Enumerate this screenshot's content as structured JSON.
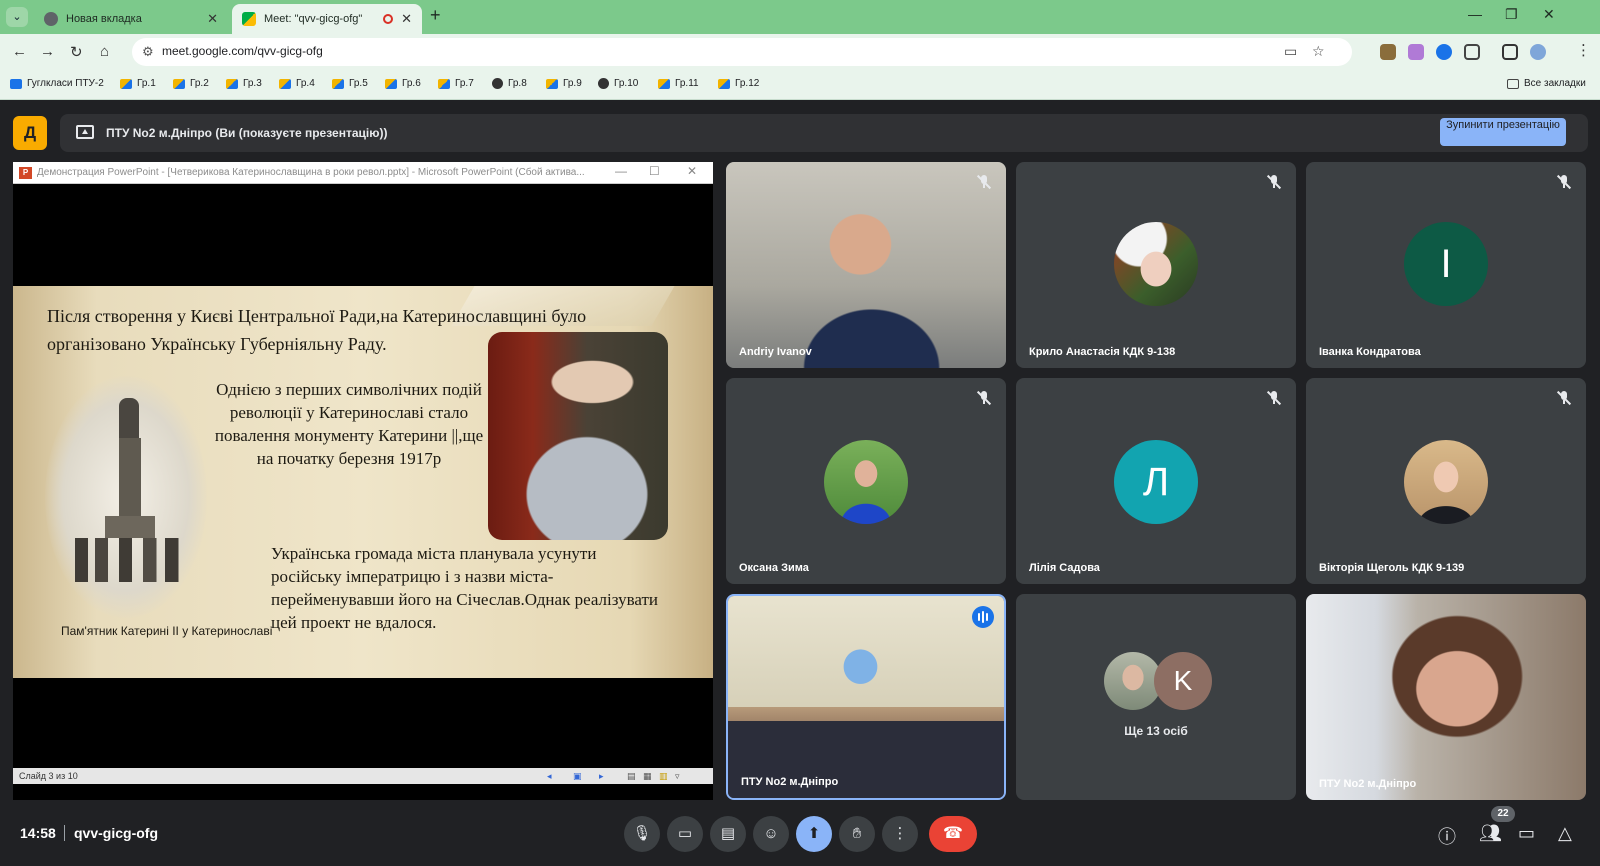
{
  "browser": {
    "tabs": [
      {
        "label": "Новая вкладка",
        "active": false
      },
      {
        "label": "Meet: \"qvv-gicg-ofg\"",
        "active": true
      }
    ],
    "url": "meet.google.com/qvv-gicg-ofg",
    "bookmarks": [
      "Гуглкласи ПТУ-2",
      "Гр.1",
      "Гр.2",
      "Гр.3",
      "Гр.4",
      "Гр.5",
      "Гр.6",
      "Гр.7",
      "Гр.8",
      "Гр.9",
      "Гр.10",
      "Гр.11",
      "Гр.12"
    ],
    "all_bookmarks": "Все закладки"
  },
  "meet": {
    "presenting_banner": "ПТУ No2 м.Дніпро (Ви (показуєте презентацію))",
    "stop_button": "Зупинити презентацію",
    "time": "14:58",
    "meeting_code": "qvv-gicg-ofg",
    "participant_count": "22",
    "participants": [
      {
        "name": "Andriy Ivanov",
        "muted": true,
        "type": "video"
      },
      {
        "name": "Крило Анастасія КДК 9-138",
        "muted": true,
        "type": "photo"
      },
      {
        "name": "Іванка Кондратова",
        "muted": true,
        "type": "letter",
        "letter": "І",
        "color": "#0d5a45"
      },
      {
        "name": "Оксана Зима",
        "muted": true,
        "type": "photo"
      },
      {
        "name": "Лілія Садова",
        "muted": true,
        "type": "letter",
        "letter": "Л",
        "color": "#12a4b0"
      },
      {
        "name": "Вікторія Щеголь КДК 9-139",
        "muted": true,
        "type": "photo"
      },
      {
        "name": "ПТУ No2 м.Дніпро",
        "speaking": true,
        "type": "video"
      },
      {
        "name": "Ще 13 осіб",
        "type": "more",
        "letter": "K",
        "color": "#8d6e63"
      },
      {
        "name": "ПТУ No2 м.Дніпро",
        "muted": false,
        "type": "video"
      }
    ]
  },
  "presentation": {
    "window_title": "Демонстрация PowerPoint - [Четверикова Катеринославщина в роки револ.pptx] - Microsoft PowerPoint (Сбой актива...",
    "slide_text_1": "Після створення у Києві Центральної Ради,на Катеринославщині було організовано Українську Губерніяльну Раду.",
    "slide_text_2": "Однією з перших символічних подій революції у Катеринославі стало повалення монументу Катерини ||,ще на початку березня 1917р",
    "slide_text_3": "Українська громада міста планувала усунути російську імператрицю і з назви міста- перейменувавши його на Січеслав.Однак реалізувати цей проект не вдалося.",
    "caption": "Пам'ятник Катерині ІІ у Катеринославі",
    "status": "Слайд 3 из 10"
  }
}
